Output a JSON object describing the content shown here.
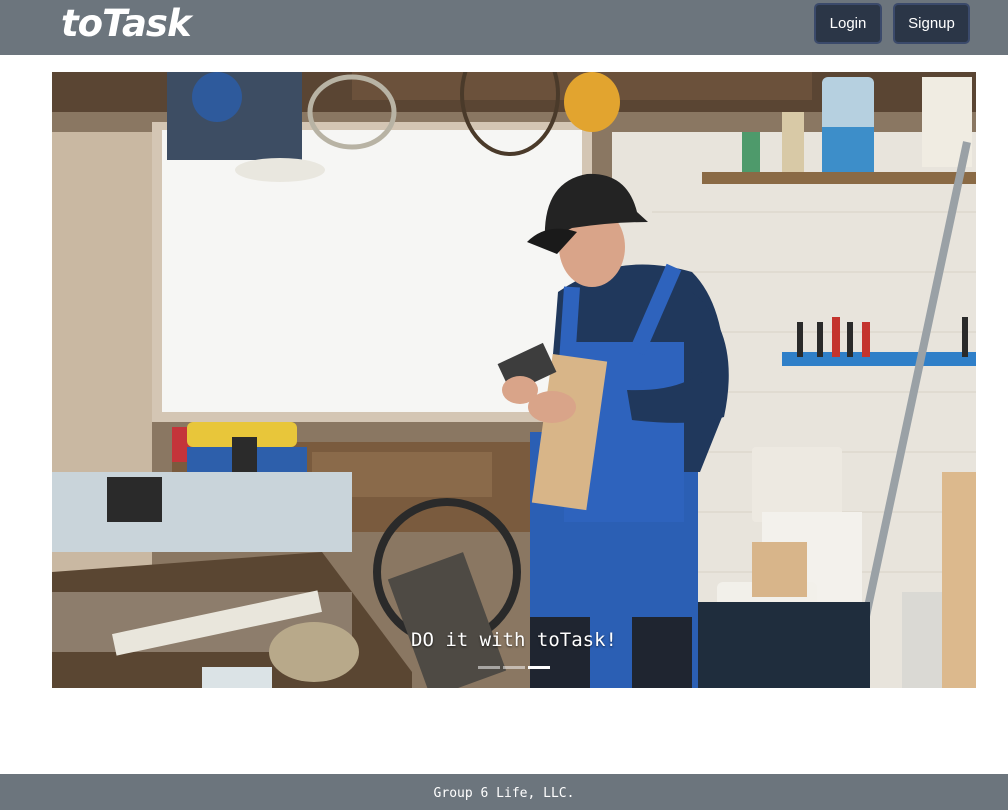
{
  "header": {
    "brand": "toTask",
    "login_label": "Login",
    "signup_label": "Signup"
  },
  "hero": {
    "image_alt": "Man in blue overalls looking at a device in a cluttered workshop",
    "caption": "DO it with toTask!",
    "slide_count": 3,
    "active_slide": 3
  },
  "footer": {
    "text": "Group 6 Life, LLC."
  },
  "colors": {
    "navbar": "#6c757d",
    "button_bg": "#2b3647",
    "button_border": "#3b4a6b",
    "footer": "#6c757d"
  }
}
